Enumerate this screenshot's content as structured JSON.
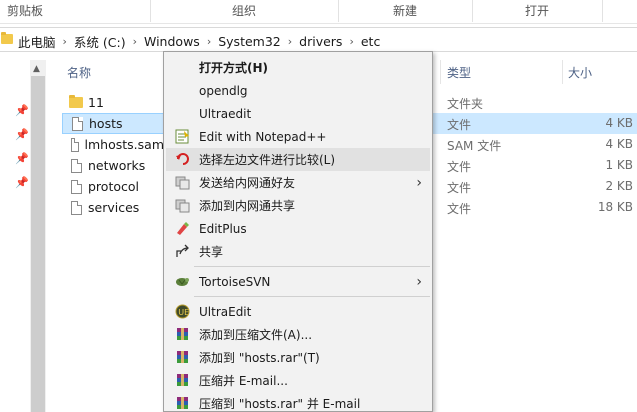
{
  "ribbon": {
    "groups": [
      "剪贴板",
      "组织",
      "新建",
      "打开"
    ]
  },
  "address": {
    "crumbs": [
      "此电脑",
      "系统 (C:)",
      "Windows",
      "System32",
      "drivers",
      "etc"
    ]
  },
  "columns": {
    "name": "名称",
    "type": "类型",
    "size": "大小"
  },
  "files": [
    {
      "name": "11",
      "kind": "folder",
      "type": "文件夹",
      "size": ""
    },
    {
      "name": "hosts",
      "kind": "file",
      "type": "文件",
      "size": "4 KB"
    },
    {
      "name": "lmhosts.sam",
      "kind": "file",
      "type": "SAM 文件",
      "size": "4 KB"
    },
    {
      "name": "networks",
      "kind": "file",
      "type": "文件",
      "size": "1 KB"
    },
    {
      "name": "protocol",
      "kind": "file",
      "type": "文件",
      "size": "2 KB"
    },
    {
      "name": "services",
      "kind": "file",
      "type": "文件",
      "size": "18 KB"
    }
  ],
  "menu": {
    "open_with": "打开方式(H)",
    "opendlg": "opendlg",
    "ultraedit_lower": "Ultraedit",
    "edit_notepad": "Edit with Notepad++",
    "compare_left": "选择左边文件进行比较(L)",
    "send_lan_friend": "发送给内网通好友",
    "add_lan_share": "添加到内网通共享",
    "editplus": "EditPlus",
    "share": "共享",
    "tortoisesvn": "TortoiseSVN",
    "ultraedit": "UltraEdit",
    "add_archive": "添加到压缩文件(A)...",
    "add_hosts_rar": "添加到 \"hosts.rar\"(T)",
    "compress_email": "压缩并 E-mail...",
    "compress_hosts_email": "压缩到 \"hosts.rar\" 并 E-mail"
  },
  "colors": {
    "selection": "#cce8ff",
    "menu_bg": "#f2f2f2",
    "hover": "#e1e1e1",
    "folder": "#f2c94c"
  }
}
